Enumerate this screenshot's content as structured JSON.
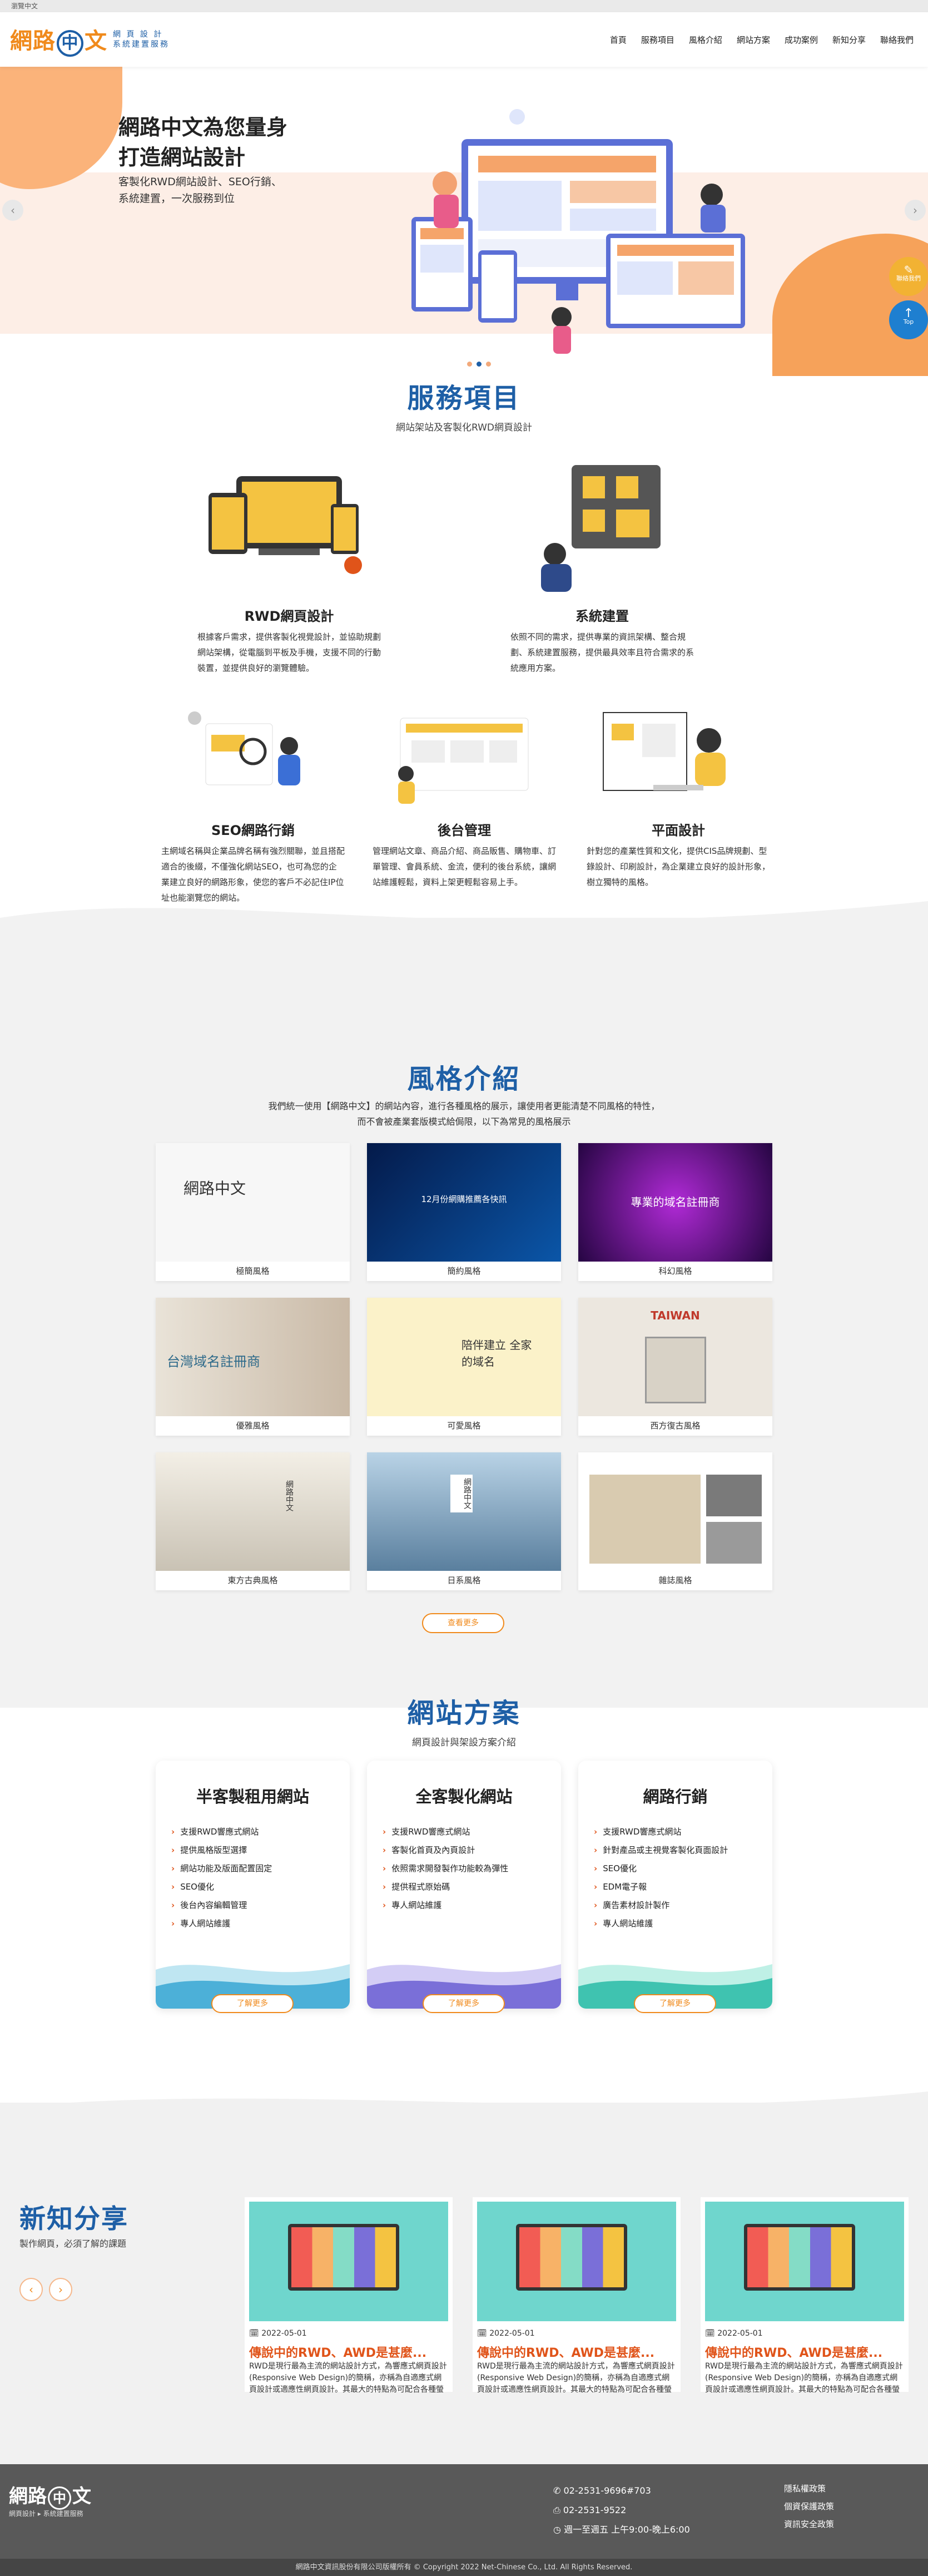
{
  "topbar": {
    "text": "瀏覽中文"
  },
  "header": {
    "logo_main_1": "網路",
    "logo_circle": "中",
    "logo_main_2": "文",
    "logo_sub_1": "網 頁 設 計",
    "logo_sub_2": "系統建置服務",
    "nav": [
      "首頁",
      "服務項目",
      "風格介紹",
      "網站方案",
      "成功案例",
      "新知分享",
      "聯絡我們"
    ]
  },
  "hero": {
    "title_line1": "網路中文為您量身",
    "title_line2": "打造網站設計",
    "desc_line1": "客製化RWD網站設計、SEO行銷、",
    "desc_line2": "系統建置，一次服務到位",
    "prev_icon": "‹",
    "next_icon": "›",
    "slide_count": 3,
    "active_slide": 2
  },
  "floating": {
    "contact_label": "聯絡我們",
    "top_label": "Top"
  },
  "services": {
    "title": "服務項目",
    "subtitle": "網站架站及客製化RWD網頁設計",
    "items": [
      {
        "title": "RWD網頁設計",
        "desc": "根據客戶需求，提供客製化視覺設計，並協助規劃網站架構，從電腦到平板及手機，支援不同的行動裝置，並提供良好的瀏覽體驗。"
      },
      {
        "title": "系統建置",
        "desc": "依照不同的需求，提供專業的資訊架構、整合規劃、系統建置服務，提供最具效率且符合需求的系統應用方案。"
      },
      {
        "title": "SEO網路行銷",
        "desc": "主網域名稱與企業品牌名稱有強烈關聯，並且搭配適合的後綴，不僅強化網站SEO，也可為您的企業建立良好的網路形象，使您的客戶不必記住IP位址也能瀏覽您的網站。"
      },
      {
        "title": "後台管理",
        "desc": "管理網站文章、商品介紹、商品販售、購物車、訂單管理、會員系統、金流，便利的後台系統，讓網站維護輕鬆，資料上架更輕鬆容易上手。"
      },
      {
        "title": "平面設計",
        "desc": "針對您的產業性質和文化，提供CIS品牌規劃、型錄設計、印刷設計，為企業建立良好的設計形象，樹立獨特的風格。"
      }
    ]
  },
  "styles": {
    "title": "風格介紹",
    "desc_line1": "我們統一使用【網路中文】的網站內容，進行各種風格的展示，讓使用者更能清楚不同風格的特性，",
    "desc_line2": "而不會被產業套版模式給侷限，以下為常見的風格展示",
    "items": [
      {
        "label": "極簡風格",
        "thumb_text": "網路中文"
      },
      {
        "label": "簡約風格",
        "thumb_text": "12月份網購推薦各快訊"
      },
      {
        "label": "科幻風格",
        "thumb_text": "專業的域名註冊商"
      },
      {
        "label": "優雅風格",
        "thumb_text": "台灣域名註冊商"
      },
      {
        "label": "可愛風格",
        "thumb_text": "陪伴建立 全家的域名"
      },
      {
        "label": "西方復古風格",
        "thumb_text": "TAIWAN"
      },
      {
        "label": "東方古典風格",
        "thumb_text": "網路中文"
      },
      {
        "label": "日系風格",
        "thumb_text": "網路中文"
      },
      {
        "label": "雜誌風格",
        "thumb_text": ""
      }
    ],
    "more_label": "查看更多"
  },
  "plans": {
    "title": "網站方案",
    "subtitle": "網頁設計與架設方案介紹",
    "items": [
      {
        "title": "半客製租用網站",
        "features": [
          "支援RWD響應式網站",
          "提供風格版型選擇",
          "網站功能及版面配置固定",
          "SEO優化",
          "後台內容編輯管理",
          "專人網站維護"
        ],
        "button": "了解更多",
        "color": "#4cb0d8"
      },
      {
        "title": "全客製化網站",
        "features": [
          "支援RWD響應式網站",
          "客製化首頁及內頁設計",
          "依照需求開發製作功能較為彈性",
          "提供程式原始碼",
          "專人網站維護"
        ],
        "button": "了解更多",
        "color": "#7a6fd8"
      },
      {
        "title": "網路行銷",
        "features": [
          "支援RWD響應式網站",
          "針對產品或主視覺客製化頁面設計",
          "SEO優化",
          "EDM電子報",
          "廣告素材設計製作",
          "專人網站維護"
        ],
        "button": "了解更多",
        "color": "#3fc3b0"
      }
    ]
  },
  "news": {
    "title": "新知分享",
    "subtitle": "製作網頁，必須了解的課題",
    "prev_icon": "‹",
    "next_icon": "›",
    "items": [
      {
        "date": "2022-05-01",
        "title": "傳說中的RWD、AWD是甚麼...",
        "desc": "RWD是現行最為主流的網站設計方式，為響應式網頁設計(Responsive Web Design)的簡稱，亦稱為自適應式網頁設計或適應性網頁設計。其最大的特點為可配合各種螢幕尺寸，..."
      },
      {
        "date": "2022-05-01",
        "title": "傳說中的RWD、AWD是甚麼...",
        "desc": "RWD是現行最為主流的網站設計方式，為響應式網頁設計(Responsive Web Design)的簡稱，亦稱為自適應式網頁設計或適應性網頁設計。其最大的特點為可配合各種螢幕尺寸，..."
      },
      {
        "date": "2022-05-01",
        "title": "傳說中的RWD、AWD是甚麼...",
        "desc": "RWD是現行最為主流的網站設計方式，為響應式網頁設計(Responsive Web Design)的簡稱，亦稱為自適應式網頁設計或適應性網頁設計。其最大的特點為可配合各種螢幕尺寸，..."
      }
    ]
  },
  "footer": {
    "logo_1": "網路",
    "logo_circle": "中",
    "logo_2": "文",
    "tagline": "網頁設計 ▸ 系統建置服務",
    "phone": "02-2531-9696#703",
    "fax": "02-2531-9522",
    "hours": "週一至週五 上午9:00-晚上6:00",
    "links": [
      "隱私權政策",
      "個資保護政策",
      "資訊安全政策"
    ],
    "copyright": "網路中文資訊股份有限公司版權所有 © Copyright 2022 Net-Chinese Co., Ltd. All Rights Reserved."
  },
  "colors": {
    "brand_blue": "#1e5fa6",
    "brand_orange": "#f08a1c",
    "accent_red": "#e0541a"
  }
}
